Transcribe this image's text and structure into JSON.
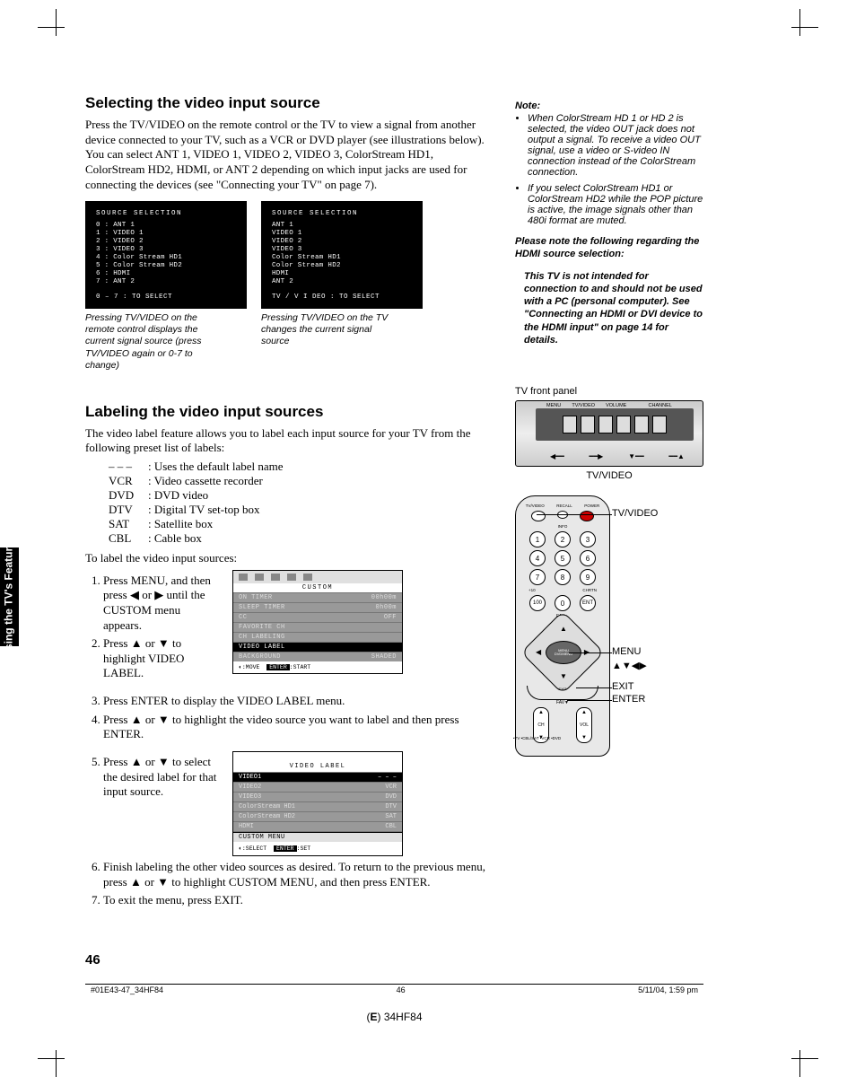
{
  "section1": {
    "heading": "Selecting the video input source",
    "body": "Press the TV/VIDEO on the remote control or the TV to view a signal from another device connected to your TV, such as a VCR or DVD player (see illustrations below). You can select ANT 1, VIDEO 1, VIDEO 2, VIDEO 3, ColorStream HD1, ColorStream HD2, HDMI, or ANT 2 depending on which input jacks are used for connecting the devices (see \"Connecting your TV\" on page 7)."
  },
  "osd1": {
    "title": "SOURCE SELECTION",
    "rows": [
      "0 : ANT 1",
      "1 : VIDEO 1",
      "2 : VIDEO 2",
      "3 : VIDEO 3",
      "4 : Color Stream HD1",
      "5 : Color Stream HD2",
      "6 : HDMI",
      "7 : ANT 2"
    ],
    "foot": "0 – 7 : TO SELECT"
  },
  "osd2": {
    "title": "SOURCE SELECTION",
    "rows": [
      "ANT 1",
      "VIDEO 1",
      "VIDEO 2",
      "VIDEO 3",
      "Color Stream HD1",
      "Color Stream HD2",
      "HDMI",
      "ANT 2"
    ],
    "foot": "TV / V I DEO : TO SELECT"
  },
  "cap1": "Pressing TV/VIDEO on the remote control displays the current signal source (press TV/VIDEO again or 0-7 to change)",
  "cap2": "Pressing TV/VIDEO on the TV changes the current signal source",
  "notes": {
    "heading": "Note:",
    "items": [
      "When ColorStream HD 1 or HD 2 is selected, the video OUT jack does not output a signal. To receive a video OUT signal, use a video or S-video IN connection instead of the ColorStream connection.",
      "If you select ColorStream HD1 or ColorStream HD2 while the POP picture is active, the image signals other than 480i format are muted."
    ],
    "hdmi1": "Please note the following regarding the HDMI source selection:",
    "hdmi2": "This TV is not intended for connection to and should not be used with a PC (personal computer). See \"Connecting an HDMI or DVI device to the HDMI input\" on page 14 for details."
  },
  "section2": {
    "heading": "Labeling the video input sources",
    "intro": "The video label feature allows you to label each input source for your TV from the following preset list of labels:",
    "labels": [
      {
        "k": "– – –",
        "v": ": Uses the default label name"
      },
      {
        "k": "VCR",
        "v": ": Video cassette recorder"
      },
      {
        "k": "DVD",
        "v": ": DVD video"
      },
      {
        "k": "DTV",
        "v": ": Digital TV set-top box"
      },
      {
        "k": "SAT",
        "v": ": Satellite box"
      },
      {
        "k": "CBL",
        "v": ": Cable box"
      }
    ],
    "lead2": "To label the video input sources:",
    "steps12": [
      "Press MENU, and then press ◀ or ▶ until the CUSTOM menu appears.",
      "Press ▲ or ▼ to highlight VIDEO LABEL."
    ],
    "custom": {
      "title": "CUSTOM",
      "rows": [
        {
          "l": "ON TIMER",
          "r": "00h00m"
        },
        {
          "l": "SLEEP TIMER",
          "r": "0h00m"
        },
        {
          "l": "CC",
          "r": "OFF"
        },
        {
          "l": "FAVORITE CH",
          "r": ""
        },
        {
          "l": "CH LABELING",
          "r": ""
        },
        {
          "l": "VIDEO LABEL",
          "r": "",
          "hl": true
        },
        {
          "l": "BACKGROUND",
          "r": "SHADED"
        }
      ],
      "foot_move": ":MOVE",
      "foot_enter": "ENTER",
      "foot_start": ":START"
    },
    "step3": "Press ENTER to display the VIDEO LABEL menu.",
    "step4": "Press ▲ or ▼ to highlight the video source you want to label and then press ENTER.",
    "step5txt": "Press ▲ or ▼ to select the desired label for that input source.",
    "vlabel": {
      "title": "VIDEO LABEL",
      "rows": [
        {
          "l": "VIDEO1",
          "r": "– – –",
          "hl": true
        },
        {
          "l": "VIDEO2",
          "r": "VCR"
        },
        {
          "l": "VIDEO3",
          "r": "DVD"
        },
        {
          "l": "ColorStream HD1",
          "r": "DTV"
        },
        {
          "l": "ColorStream HD2",
          "r": "SAT"
        },
        {
          "l": "HDMI",
          "r": "CBL"
        }
      ],
      "cm": "CUSTOM MENU",
      "foot_sel": ":SELECT",
      "foot_enter": "ENTER",
      "foot_set": ":SET"
    },
    "step6": "Finish labeling the other video sources as desired. To return to the previous menu, press ▲ or ▼ to highlight CUSTOM MENU, and then press ENTER.",
    "step7": "To exit the menu, press EXIT."
  },
  "tvpanel": {
    "label": "TV front panel",
    "btns": [
      "MENU",
      "TV/VIDEO",
      "VOLUME",
      "",
      "CHANNEL",
      ""
    ],
    "cap": "TV/VIDEO"
  },
  "remote": {
    "top": [
      "TV/VIDEO",
      "RECALL",
      "POWER"
    ],
    "info": "INFO",
    "ten": "+10",
    "chrtn": "CHRTN",
    "fav": "FAV▲",
    "menu": "MENU",
    "dvdmenu": "DVDMENU",
    "exit": "EXIT",
    "fav2": "FAV▼",
    "ch": "CH",
    "vol": "VOL",
    "sidelabels": "•TV\n•CBL/SAT\n•VCR\n•DVD",
    "callouts": {
      "tvvideo": "TV/VIDEO",
      "menu": "MENU",
      "arrows": "▲▼◀▶",
      "exit": "EXIT",
      "enter": "ENTER"
    }
  },
  "sidetab": "Using the TV's\nFeatures",
  "pagenum": "46",
  "footer": {
    "file": "#01E43-47_34HF84",
    "pg": "46",
    "ts": "5/11/04, 1:59 pm"
  },
  "model": "(E) 34HF84"
}
